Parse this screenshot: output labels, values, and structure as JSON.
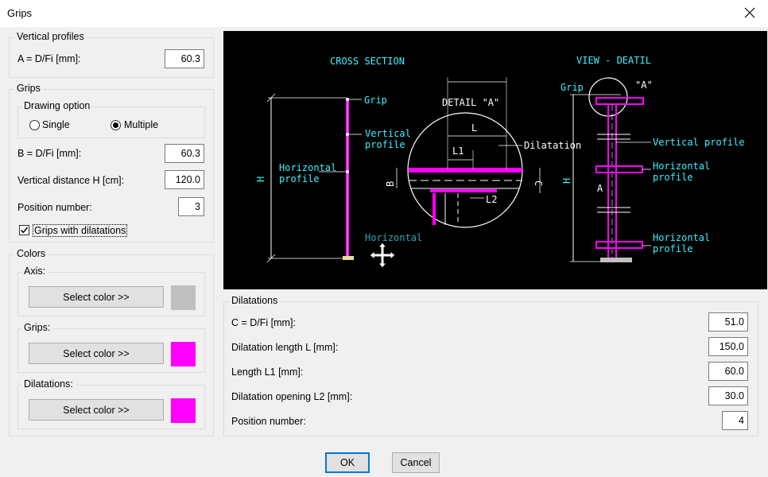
{
  "window": {
    "title": "Grips"
  },
  "vertical_profiles": {
    "title": "Vertical profiles",
    "a_label": "A = D/Fi [mm]:",
    "a_value": "60.3"
  },
  "grips": {
    "title": "Grips",
    "drawing_option": {
      "title": "Drawing option",
      "single_label": "Single",
      "multiple_label": "Multiple",
      "selected": "Multiple"
    },
    "b_label": "B = D/Fi [mm]:",
    "b_value": "60.3",
    "h_label": "Vertical distance H [cm]:",
    "h_value": "120.0",
    "pos_label": "Position number:",
    "pos_value": "3",
    "dilatations_check_label": "Grips with dilatations",
    "dilatations_checked": true
  },
  "colors": {
    "title": "Colors",
    "select_label": "Select color >>",
    "axis": {
      "label": "Axis:",
      "color": "#c0c0c0"
    },
    "grips": {
      "label": "Grips:",
      "color": "#ff00ff"
    },
    "dilatations": {
      "label": "Dilatations:",
      "color": "#ff00ff"
    }
  },
  "drawing": {
    "cross_section": "CROSS SECTION",
    "view_detail": "VIEW - DEATIL",
    "detail_a": "DETAIL \"A\"",
    "grip": "Grip",
    "vertical": "Vertical",
    "profile": "profile",
    "vertical_profile": "Vertical profile",
    "horizontal": "Horizontal",
    "dilatation": "Dilatation",
    "a_mark": "\"A\"",
    "h": "H",
    "b": "B",
    "c": "C",
    "l": "L",
    "l1": "L1",
    "l2": "L2",
    "a": "A",
    "colors": {
      "cyan": "#3ff0ff",
      "magenta": "#ff00ff",
      "white": "#ffffff",
      "yellow": "#e8e090"
    }
  },
  "dilatations": {
    "title": "Dilatations",
    "c_label": "C = D/Fi [mm]:",
    "c_value": "51.0",
    "length_label": "Dilatation length L [mm]:",
    "length_value": "150.0",
    "l1_label": "Length L1 [mm]:",
    "l1_value": "60.0",
    "l2_label": "Dilatation opening L2 [mm]:",
    "l2_value": "30.0",
    "pos_label": "Position number:",
    "pos_value": "4"
  },
  "buttons": {
    "ok": "OK",
    "cancel": "Cancel"
  }
}
